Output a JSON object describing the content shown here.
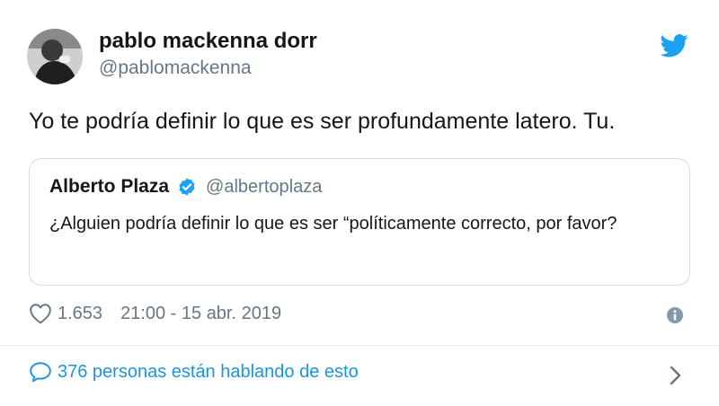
{
  "tweet": {
    "author": {
      "display_name": "pablo mackenna dorr",
      "handle": "@pablomackenna",
      "avatar_icon": "user-avatar-photo"
    },
    "text": "Yo te podría definir lo que es ser profundamente latero. Tu.",
    "quoted": {
      "display_name": "Alberto Plaza",
      "handle": "@albertoplaza",
      "verified": true,
      "text": "¿Alguien podría definir lo que es ser “políticamente correcto, por favor?"
    },
    "likes": "1.653",
    "timestamp": "21:00 - 15 abr. 2019",
    "conversation_text": "376 personas están hablando de esto"
  },
  "colors": {
    "twitter_blue": "#1da1f2",
    "link_blue": "#1b95e0",
    "secondary_text": "#657786",
    "border": "#d6dde3"
  },
  "icons": {
    "brand": "twitter-bird-icon",
    "like": "heart-icon",
    "info": "info-icon",
    "reply": "speech-bubble-icon",
    "next": "chevron-right-icon",
    "verified": "verified-badge-icon"
  }
}
